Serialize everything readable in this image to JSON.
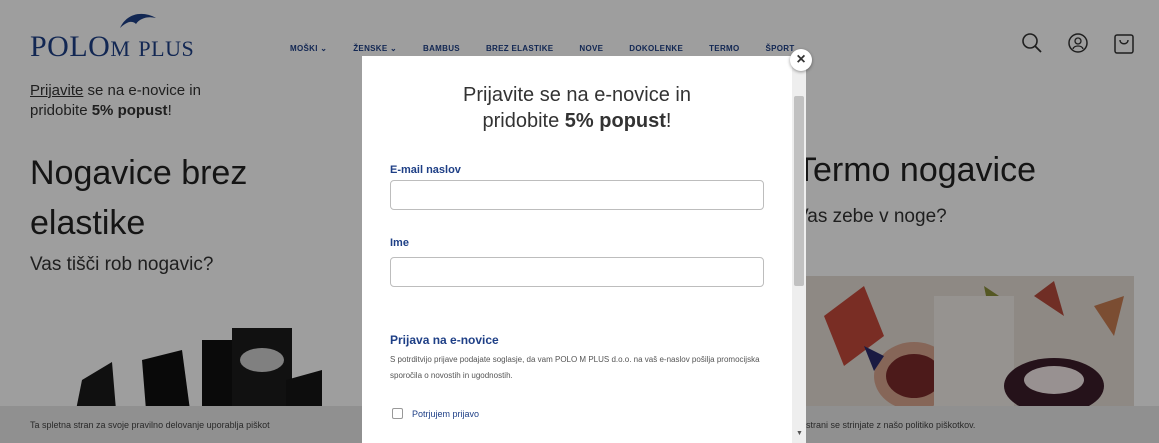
{
  "header": {
    "logo_main": "POLO",
    "logo_m": "M",
    "logo_plus": "PLUS",
    "nav": [
      "MOŠKI ⌄",
      "ŽENSKE ⌄",
      "BAMBUS",
      "BREZ ELASTIKE",
      "NOVE",
      "DOKOLENKE",
      "TERMO",
      "ŠPORT"
    ],
    "icons": [
      "search-icon",
      "user-icon",
      "cart-icon"
    ]
  },
  "promo": {
    "link": "Prijavite",
    "text1": " se na e-novice in",
    "text2": "pridobite ",
    "bold": "5% popust",
    "tail": "!"
  },
  "left": {
    "title": "Nogavice brez elastike",
    "subtitle": "Vas tišči rob nogavic?"
  },
  "right": {
    "title": "Termo nogavice",
    "subtitle": "Vas zebe v noge?"
  },
  "cookie": {
    "left": "Ta spletna stran za svoje pravilno delovanje uporablja piškot",
    "right": "strani se strinjate z našo politiko piškotkov."
  },
  "modal": {
    "title_line1": "Prijavite se na e-novice in",
    "title_pre": "pridobite ",
    "title_bold": "5% popust",
    "title_end": "!",
    "email_label": "E-mail naslov",
    "name_label": "Ime",
    "section_title": "Prijava na e-novice",
    "consent_text": "S potrditvijo prijave podajate soglasje, da vam POLO M PLUS d.o.o. na vaš e-naslov pošilja promocijska sporočila o novostih in ugodnostih.",
    "checkbox_label": "Potrjujem prijavo",
    "close_glyph": "×"
  },
  "colors": {
    "brand": "#1e3f86",
    "overlay": "rgba(0,0,0,0.38)"
  }
}
